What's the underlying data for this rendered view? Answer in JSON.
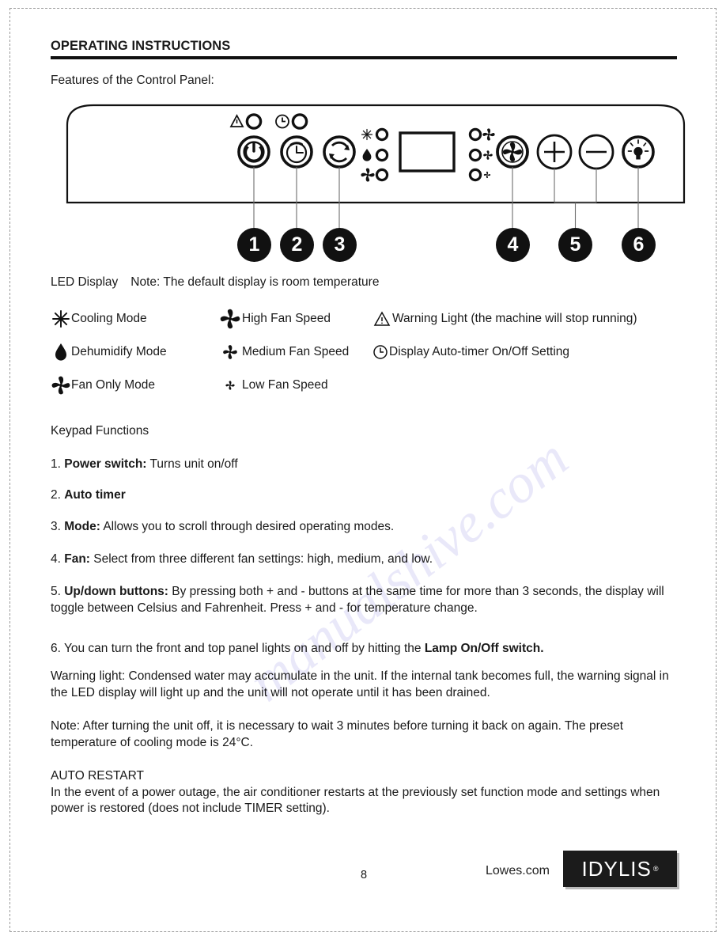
{
  "document": {
    "section_title": "OPERATING INSTRUCTIONS",
    "lead_line": "Features of the Control Panel:",
    "page_number": "8"
  },
  "control_panel": {
    "top_indicators": [
      {
        "icon": "warning-triangle-icon",
        "led": "led-circle"
      },
      {
        "icon": "clock-icon",
        "led": "led-circle"
      }
    ],
    "buttons": [
      {
        "name": "power-button",
        "icon": "power-icon",
        "callout": "1"
      },
      {
        "name": "timer-button",
        "icon": "clock-dial-icon",
        "callout": "2"
      },
      {
        "name": "mode-button",
        "icon": "cycle-arrows-icon",
        "callout": "3"
      },
      {
        "name": "fan-button",
        "icon": "fan-blade-icon",
        "callout": "4"
      },
      {
        "name": "plus-button",
        "icon": "plus-icon",
        "callout": "5"
      },
      {
        "name": "minus-button",
        "icon": "minus-icon",
        "callout": "5"
      },
      {
        "name": "lamp-button",
        "icon": "lightbulb-icon",
        "callout": "6"
      }
    ],
    "mode_leds": [
      "snowflake-icon",
      "water-drop-icon",
      "fan-icon"
    ],
    "fan_speed_leds": [
      "high-fan-icon",
      "medium-fan-icon",
      "low-fan-icon"
    ],
    "display": "led-display-screen",
    "callout_numbers": [
      "1",
      "2",
      "3",
      "4",
      "5",
      "6"
    ]
  },
  "led_legend": {
    "heading_label": "LED Display",
    "heading_note": "Note: The default display is room temperature",
    "rows": [
      {
        "a": {
          "icon": "snowflake-icon",
          "text": "Cooling Mode"
        },
        "b": {
          "icon": "high-fan-icon",
          "text": "High Fan Speed"
        },
        "c": {
          "icon": "warning-triangle-icon",
          "text": "Warning Light (the machine will stop running)"
        }
      },
      {
        "a": {
          "icon": "water-drop-icon",
          "text": "Dehumidify Mode"
        },
        "b": {
          "icon": "medium-fan-icon",
          "text": "Medium Fan Speed"
        },
        "c": {
          "icon": "clock-icon",
          "text": "Display Auto-timer On/Off Setting"
        }
      },
      {
        "a": {
          "icon": "fan-icon",
          "text": "Fan Only Mode"
        },
        "b": {
          "icon": "low-fan-icon",
          "text": "Low Fan Speed"
        },
        "c": {
          "icon": "",
          "text": ""
        }
      }
    ]
  },
  "keypad": {
    "heading": "Keypad Functions",
    "item1_num": "1. ",
    "item1_bold": "Power switch:",
    "item1_rest": " Turns unit on/off",
    "item2_num": "2. ",
    "item2_bold": "Auto timer",
    "item3_num": "3. ",
    "item3_bold": "Mode:",
    "item3_rest": " Allows you to scroll through desired operating modes.",
    "item4_num": "4. ",
    "item4_bold": "Fan:",
    "item4_rest": " Select from three different fan settings: high, medium,  and low.",
    "item5_num": "5. ",
    "item5_bold": "Up/down buttons:",
    "item5_rest": " By pressing both + and - buttons at the same time for more than 3 seconds, the display will toggle  between Celsius and Fahrenheit. Press + and - for temperature change.",
    "item6_pre": "6. You can turn the front and top panel lights on and off by hitting the ",
    "item6_bold": "Lamp On/Off switch."
  },
  "notes": {
    "warning_light": "Warning light: Condensed water may accumulate in the unit. If the internal tank becomes full, the warning signal in the LED display will light up and the unit will not operate until it has been drained.",
    "restart_note": "Note: After turning the unit off, it is necessary to wait 3 minutes before turning it back on again. The preset temperature of cooling mode is 24°C.",
    "auto_restart_title": "AUTO RESTART",
    "auto_restart_body": "In the event of a power outage, the air conditioner restarts at the previously set function mode and settings when power is restored (does not include TIMER setting)."
  },
  "footer": {
    "lowes_text": "Lowes.com",
    "brand": "IDYLIS",
    "registered_mark": "®"
  },
  "watermark": {
    "text": "manualshive.com"
  },
  "colors": {
    "ink": "#1a1a1a",
    "rule": "#111111",
    "border": "#9a9a9a",
    "logo_bg": "#1b1b1b",
    "watermark": "#7873d7"
  }
}
